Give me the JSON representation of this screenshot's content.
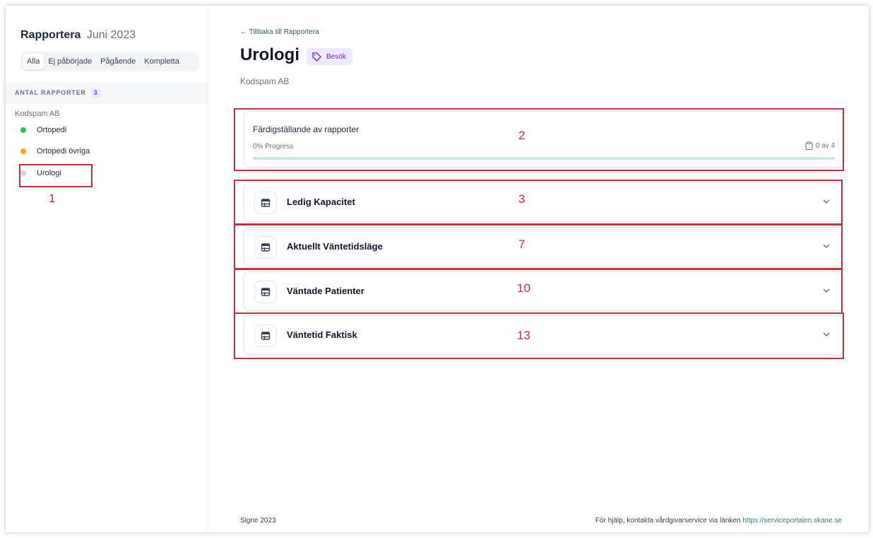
{
  "sidebar": {
    "title": "Rapportera",
    "month": "Juni 2023",
    "filters": [
      "Alla",
      "Ej påbörjade",
      "Pågående",
      "Kompletta"
    ],
    "active_filter": "Alla",
    "report_count_label": "ANTAL RAPPORTER",
    "report_count": "3",
    "org": "Kodspam AB",
    "items": [
      {
        "label": "Ortopedi",
        "status_color": "#22c55e"
      },
      {
        "label": "Ortopedi övriga",
        "status_color": "#f5a524"
      },
      {
        "label": "Urologi",
        "status_color": "#d1d5db"
      }
    ]
  },
  "main": {
    "back_link": "← Tillbaka till Rapportera",
    "title": "Urologi",
    "tag": "Besök",
    "subtitle": "Kodspam AB",
    "progress": {
      "title": "Färdigställande av rapporter",
      "text": "0% Progress",
      "count": "0 av 4",
      "value": 0
    },
    "sections": [
      {
        "title": "Ledig Kapacitet",
        "icon": "calendar-icon"
      },
      {
        "title": "Aktuellt Väntetidsläge",
        "icon": "calendar-icon"
      },
      {
        "title": "Väntade Patienter",
        "icon": "calendar-icon"
      },
      {
        "title": "Väntetid Faktisk",
        "icon": "calendar-icon"
      }
    ]
  },
  "annotations": [
    "1",
    "2",
    "3",
    "7",
    "10",
    "13"
  ],
  "footer": {
    "left": "Signe 2023",
    "help_text": "För hjälp, kontakta vårdgivarservice via länken",
    "help_link": "https://serviceportalen.skane.se"
  },
  "colors": {
    "accent": "#2f8f80",
    "annotation": "#c0343f",
    "tag_bg": "#ede9fe"
  }
}
